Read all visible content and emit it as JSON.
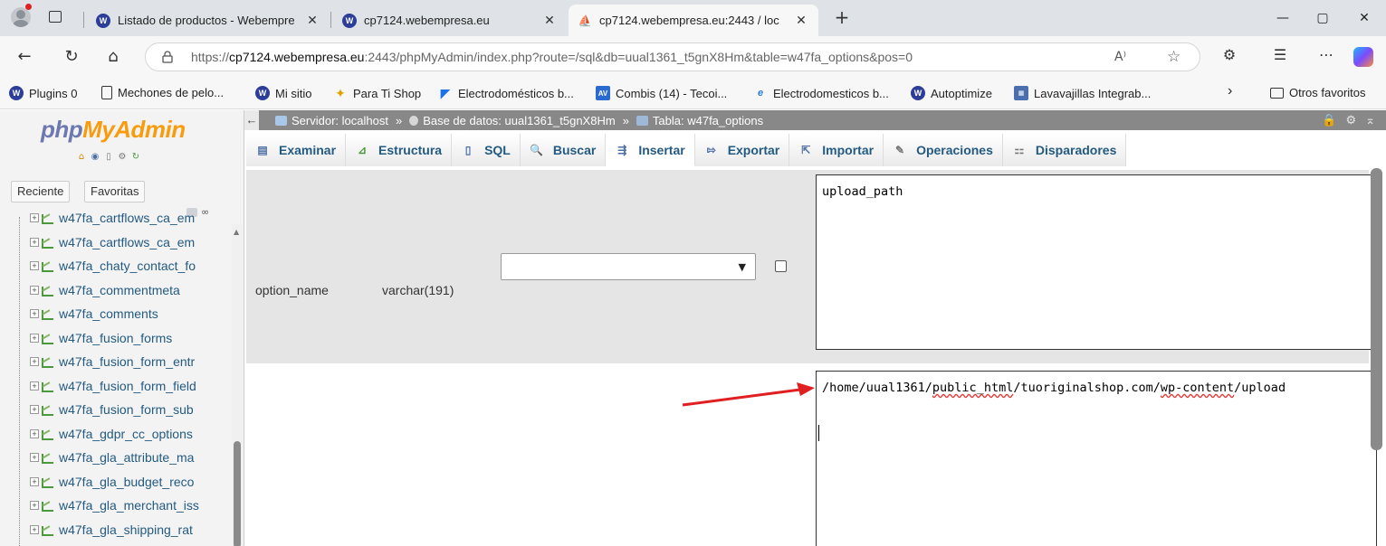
{
  "browser": {
    "tabs": [
      {
        "label": "Listado de productos - Webempre",
        "favicon": "wordpress-icon",
        "active": false
      },
      {
        "label": "cp7124.webempresa.eu",
        "favicon": "wordpress-icon",
        "active": false
      },
      {
        "label": "cp7124.webempresa.eu:2443 / loc",
        "favicon": "phpmyadmin-icon",
        "active": true
      }
    ],
    "tab_close": "✕",
    "new_tab": "+",
    "window": {
      "minimize": "—",
      "restore": "▢",
      "close": "✕"
    },
    "url": {
      "prefix": "https://",
      "host": "cp7124.webempresa.eu",
      "rest": ":2443/phpMyAdmin/index.php?route=/sql&db=uual1361_t5gnX8Hm&table=w47fa_options&pos=0"
    },
    "read_aloud": "A⁾",
    "bookmarks": [
      {
        "label": "Plugins 0",
        "icon": "wordpress-icon"
      },
      {
        "label": "Mechones de pelo...",
        "icon": "page-icon"
      },
      {
        "label": "Mi sitio",
        "icon": "wordpress-icon"
      },
      {
        "label": "Para Ti Shop",
        "icon": "shop-icon"
      },
      {
        "label": "Electrodomésticos b...",
        "icon": "electro-icon"
      },
      {
        "label": "Combis (14) - Tecoi...",
        "icon": "combis-icon"
      },
      {
        "label": "Electrodomesticos b...",
        "icon": "edge-icon"
      },
      {
        "label": "Autoptimize",
        "icon": "wordpress-icon"
      },
      {
        "label": "Lavavajillas Integrab...",
        "icon": "lava-icon"
      }
    ],
    "bookmarks_more": "›",
    "other_favorites": "Otros favoritos"
  },
  "pma": {
    "logo_php": "php",
    "logo_myadmin": "MyAdmin",
    "nav_tabs": {
      "recent": "Reciente",
      "favorites": "Favoritas"
    },
    "tree": [
      "w47fa_cartflows_ca_em",
      "w47fa_cartflows_ca_em",
      "w47fa_chaty_contact_fo",
      "w47fa_commentmeta",
      "w47fa_comments",
      "w47fa_fusion_forms",
      "w47fa_fusion_form_entr",
      "w47fa_fusion_form_field",
      "w47fa_fusion_form_sub",
      "w47fa_gdpr_cc_options",
      "w47fa_gla_attribute_ma",
      "w47fa_gla_budget_reco",
      "w47fa_gla_merchant_iss",
      "w47fa_gla_shipping_rat"
    ],
    "breadcrumb": {
      "server": "Servidor: localhost",
      "sep": "»",
      "database": "Base de datos: uual1361_t5gnX8Hm",
      "table": "Tabla: w47fa_options"
    },
    "menu": [
      {
        "label": "Examinar",
        "icon": "browse-icon"
      },
      {
        "label": "Estructura",
        "icon": "structure-icon"
      },
      {
        "label": "SQL",
        "icon": "sql-icon"
      },
      {
        "label": "Buscar",
        "icon": "search-icon"
      },
      {
        "label": "Insertar",
        "icon": "insert-icon",
        "active": true
      },
      {
        "label": "Exportar",
        "icon": "export-icon"
      },
      {
        "label": "Importar",
        "icon": "import-icon"
      },
      {
        "label": "Operaciones",
        "icon": "wrench-icon"
      },
      {
        "label": "Disparadores",
        "icon": "triggers-icon"
      }
    ],
    "row": {
      "column": "option_name",
      "type": "varchar(191)",
      "value": "upload_path"
    },
    "row2": {
      "value_start": "/home/uual1361/",
      "value_underlined1": "public_html",
      "value_mid": "/tuoriginalshop.com/",
      "value_underlined2": "wp-content",
      "value_end": "/upload"
    }
  }
}
